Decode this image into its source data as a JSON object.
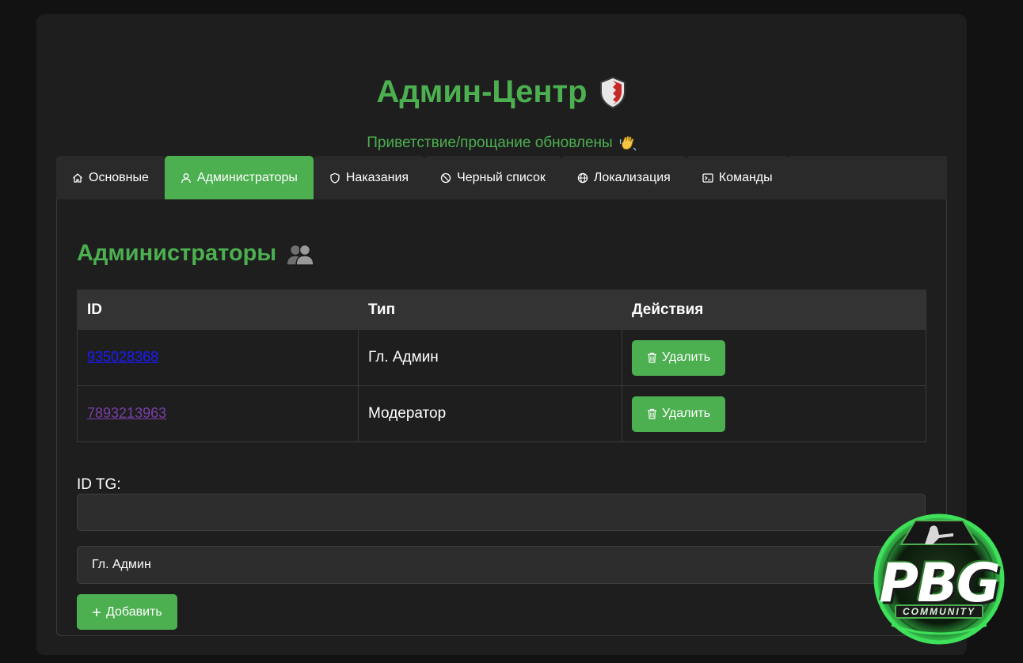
{
  "header": {
    "title": "Админ-Центр",
    "notice": "Приветствие/прощание обновлены"
  },
  "tabs": [
    {
      "label": "Основные",
      "icon": "home-icon",
      "active": false
    },
    {
      "label": "Администраторы",
      "icon": "user-icon",
      "active": true
    },
    {
      "label": "Наказания",
      "icon": "shield-icon",
      "active": false
    },
    {
      "label": "Черный список",
      "icon": "ban-icon",
      "active": false
    },
    {
      "label": "Локализация",
      "icon": "globe-icon",
      "active": false
    },
    {
      "label": "Команды",
      "icon": "terminal-icon",
      "active": false
    }
  ],
  "admins_section": {
    "title": "Администраторы",
    "columns": [
      "ID",
      "Тип",
      "Действия"
    ],
    "rows": [
      {
        "id": "935028368",
        "type": "Гл. Админ",
        "action": "Удалить",
        "link_state": "unvisited"
      },
      {
        "id": "7893213963",
        "type": "Модератор",
        "action": "Удалить",
        "link_state": "visited"
      }
    ]
  },
  "form": {
    "id_label": "ID TG:",
    "id_value": "",
    "role_selected": "Гл. Админ",
    "add_label": "Добавить"
  },
  "logo": {
    "word": "PBG",
    "sub": "COMMUNITY"
  },
  "colors": {
    "accent": "#4caf50",
    "background": "#121212",
    "panel": "#1e1e1e",
    "tab": "#2a2a2a",
    "unvisited_link": "#1a1aff",
    "visited_link": "#7b3fa8"
  }
}
